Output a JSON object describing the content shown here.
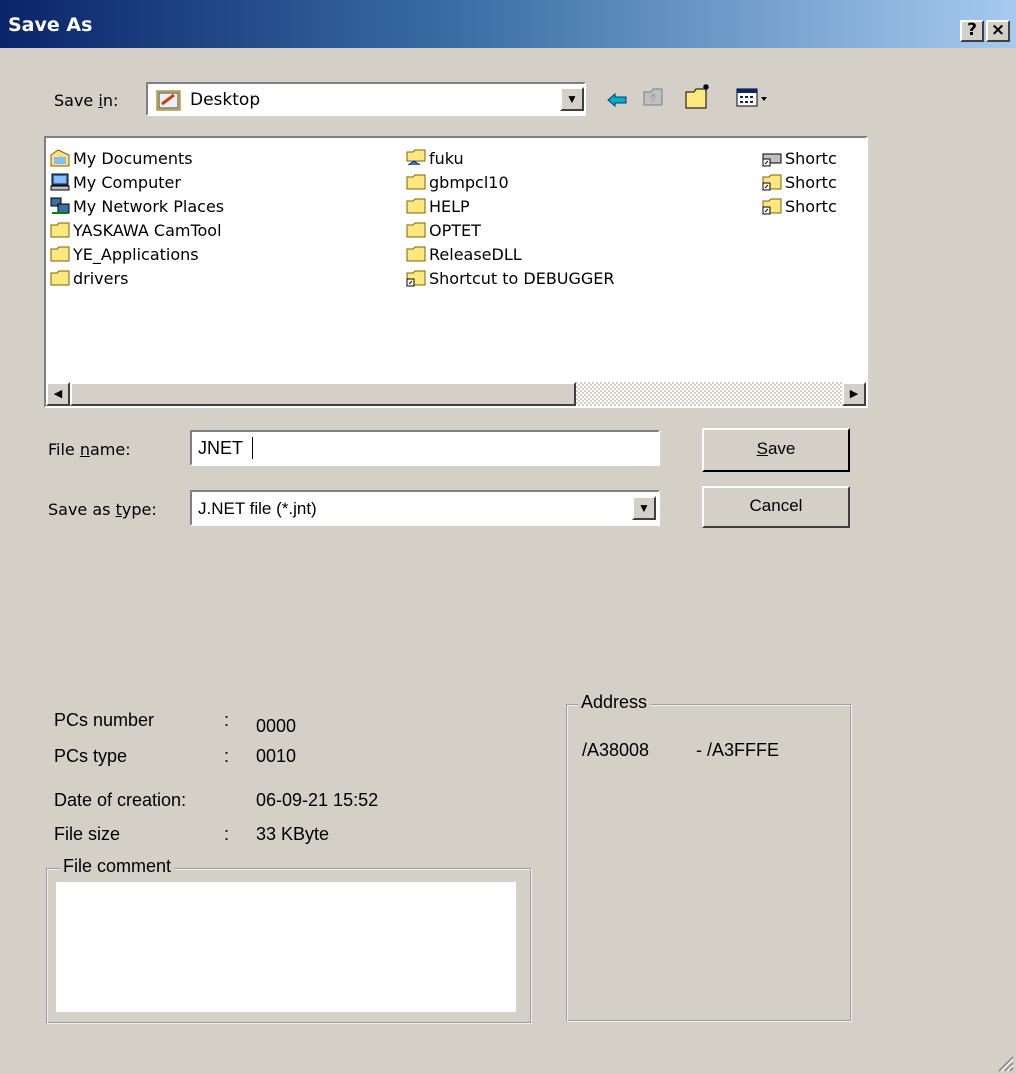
{
  "window": {
    "title": "Save As",
    "help_button": "?",
    "close_button": "×"
  },
  "save_in": {
    "label": "Save in:",
    "value": "Desktop"
  },
  "files": [
    {
      "name": "My Documents",
      "icon": "my-documents-icon"
    },
    {
      "name": "My Computer",
      "icon": "my-computer-icon"
    },
    {
      "name": "My Network Places",
      "icon": "network-places-icon"
    },
    {
      "name": "YASKAWA CamTool",
      "icon": "folder-icon"
    },
    {
      "name": "YE_Applications",
      "icon": "folder-icon"
    },
    {
      "name": "drivers",
      "icon": "folder-icon"
    },
    {
      "name": "fuku",
      "icon": "shared-folder-icon"
    },
    {
      "name": "gbmpcl10",
      "icon": "folder-icon"
    },
    {
      "name": "HELP",
      "icon": "folder-icon"
    },
    {
      "name": "OPTET",
      "icon": "folder-icon"
    },
    {
      "name": "ReleaseDLL",
      "icon": "folder-icon"
    },
    {
      "name": "Shortcut to DEBUGGER",
      "icon": "folder-shortcut-icon"
    },
    {
      "name": "Shortc",
      "icon": "drive-shortcut-icon"
    },
    {
      "name": "Shortc",
      "icon": "folder-shortcut-icon"
    },
    {
      "name": "Shortc",
      "icon": "folder-shortcut-icon"
    }
  ],
  "file_name": {
    "label": "File name:",
    "value": "JNET"
  },
  "save_as_type": {
    "label": "Save as type:",
    "value": "J.NET file (*.jnt)"
  },
  "buttons": {
    "save": "Save",
    "cancel": "Cancel"
  },
  "info": {
    "pcs_number_label": "PCs number",
    "pcs_number_sep": ":",
    "pcs_number": "0000",
    "pcs_type_label": "PCs type",
    "pcs_type_sep": ":",
    "pcs_type": "0010",
    "date_label": "Date of creation:",
    "date": "06-09-21 15:52",
    "size_label": "File size",
    "size_sep": ":",
    "size": "33 KByte"
  },
  "file_comment": {
    "title": "File comment",
    "value": ""
  },
  "address": {
    "title": "Address",
    "start": "/A38008",
    "end": "- /A3FFFE"
  }
}
